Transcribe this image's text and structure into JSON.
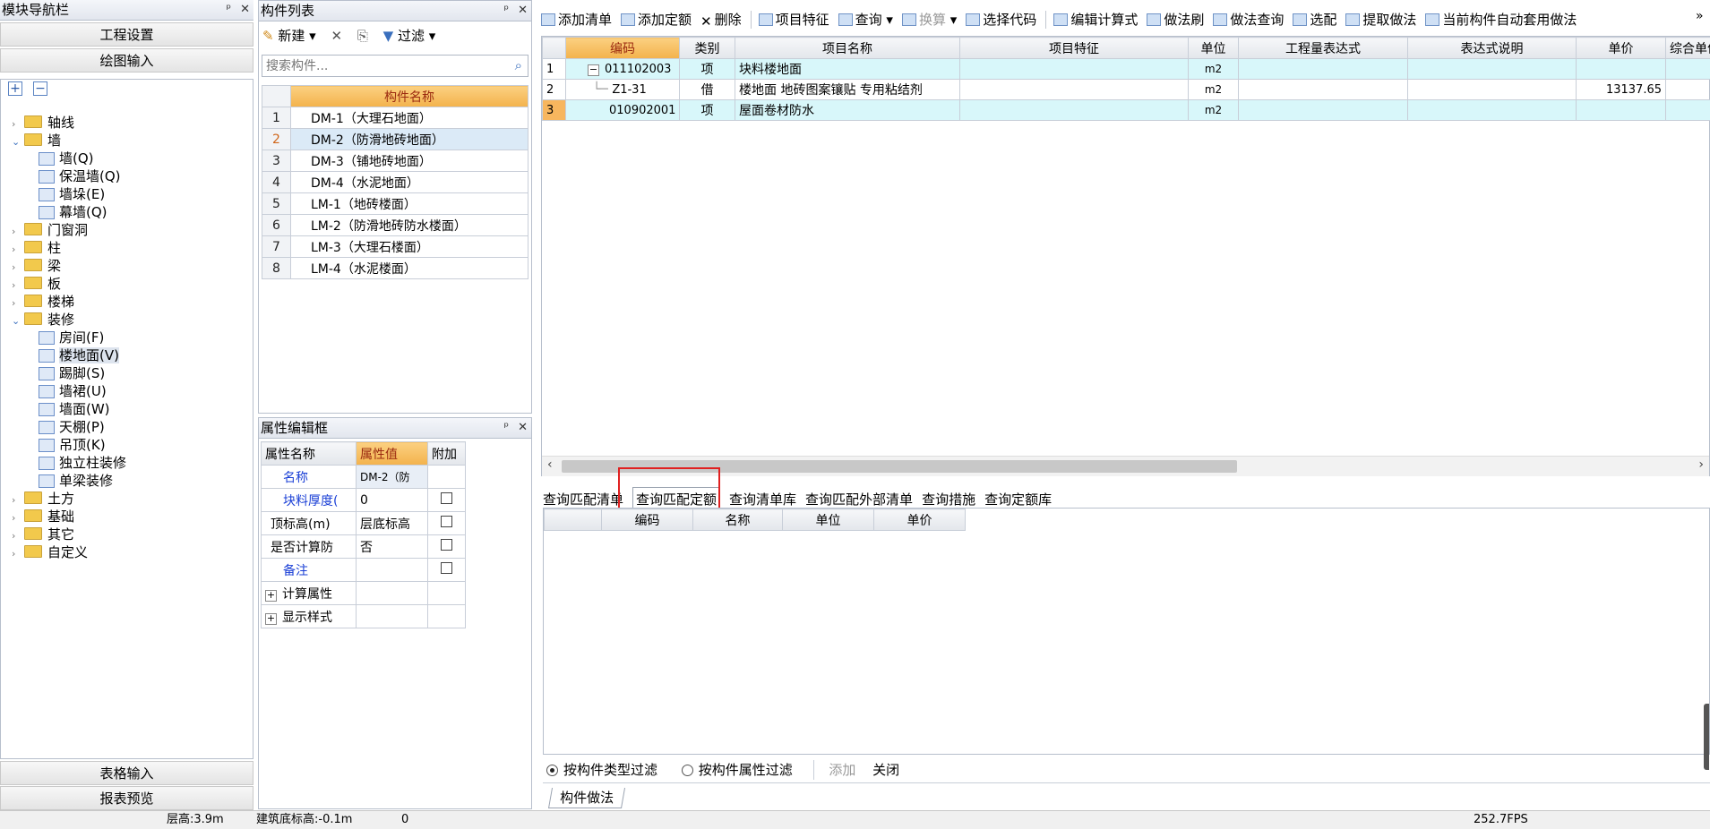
{
  "nav": {
    "title": "模块导航栏",
    "pin_icon": "pin-icon",
    "close_icon": "close-icon",
    "buttons": [
      "工程设置",
      "绘图输入"
    ],
    "bottom_buttons": [
      "表格输入",
      "报表预览"
    ],
    "tree": [
      {
        "label": "轴线",
        "level": 0,
        "state": "collapsed"
      },
      {
        "label": "墙",
        "level": 0,
        "state": "expanded"
      },
      {
        "label": "墙(Q)",
        "level": 1
      },
      {
        "label": "保温墙(Q)",
        "level": 1
      },
      {
        "label": "墙垛(E)",
        "level": 1
      },
      {
        "label": "幕墙(Q)",
        "level": 1
      },
      {
        "label": "门窗洞",
        "level": 0,
        "state": "collapsed"
      },
      {
        "label": "柱",
        "level": 0,
        "state": "collapsed"
      },
      {
        "label": "梁",
        "level": 0,
        "state": "collapsed"
      },
      {
        "label": "板",
        "level": 0,
        "state": "collapsed"
      },
      {
        "label": "楼梯",
        "level": 0,
        "state": "collapsed"
      },
      {
        "label": "装修",
        "level": 0,
        "state": "expanded"
      },
      {
        "label": "房间(F)",
        "level": 1
      },
      {
        "label": "楼地面(V)",
        "level": 1,
        "selected": true
      },
      {
        "label": "踢脚(S)",
        "level": 1
      },
      {
        "label": "墙裙(U)",
        "level": 1
      },
      {
        "label": "墙面(W)",
        "level": 1
      },
      {
        "label": "天棚(P)",
        "level": 1
      },
      {
        "label": "吊顶(K)",
        "level": 1
      },
      {
        "label": "独立柱装修",
        "level": 1
      },
      {
        "label": "单梁装修",
        "level": 1
      },
      {
        "label": "土方",
        "level": 0,
        "state": "collapsed"
      },
      {
        "label": "基础",
        "level": 0,
        "state": "collapsed"
      },
      {
        "label": "其它",
        "level": 0,
        "state": "collapsed"
      },
      {
        "label": "自定义",
        "level": 0,
        "state": "collapsed"
      }
    ]
  },
  "components": {
    "title": "构件列表",
    "new_label": "新建",
    "filter_label": "过滤",
    "search_placeholder": "搜索构件...",
    "column_header": "构件名称",
    "rows": [
      {
        "num": "1",
        "name": "DM-1（大理石地面）"
      },
      {
        "num": "2",
        "name": "DM-2（防滑地砖地面）",
        "selected": true
      },
      {
        "num": "3",
        "name": "DM-3（铺地砖地面）"
      },
      {
        "num": "4",
        "name": "DM-4（水泥地面）"
      },
      {
        "num": "5",
        "name": "LM-1（地砖楼面）"
      },
      {
        "num": "6",
        "name": "LM-2（防滑地砖防水楼面）"
      },
      {
        "num": "7",
        "name": "LM-3（大理石楼面）"
      },
      {
        "num": "8",
        "name": "LM-4（水泥楼面）"
      }
    ]
  },
  "properties": {
    "title": "属性编辑框",
    "headers": [
      "属性名称",
      "属性值",
      "附加"
    ],
    "rows": [
      {
        "name": "名称",
        "value": "DM-2（防",
        "blue": true,
        "check": false
      },
      {
        "name": "块料厚度(",
        "value": "0",
        "blue": true,
        "check": true
      },
      {
        "name": "顶标高(m)",
        "value": "层底标高",
        "blue": false,
        "check": true
      },
      {
        "name": "是否计算防",
        "value": "否",
        "blue": false,
        "check": true
      },
      {
        "name": "备注",
        "value": "",
        "blue": true,
        "check": true
      },
      {
        "name": "计算属性",
        "value": "",
        "expander": true
      },
      {
        "name": "显示样式",
        "value": "",
        "expander": true
      }
    ]
  },
  "toolbar": {
    "items": [
      "添加清单",
      "添加定额",
      "删除",
      "项目特征",
      "查询",
      "换算",
      "选择代码",
      "编辑计算式",
      "做法刷",
      "做法查询",
      "选配",
      "提取做法",
      "当前构件自动套用做法"
    ]
  },
  "main_table": {
    "headers": [
      "编码",
      "类别",
      "项目名称",
      "项目特征",
      "单位",
      "工程量表达式",
      "表达式说明",
      "单价",
      "综合单价"
    ],
    "rows": [
      {
        "num": "1",
        "code": "011102003",
        "type": "项",
        "name": "块料楼地面",
        "feature": "",
        "unit": "m2",
        "expr": "",
        "desc": "",
        "price": "",
        "cyan": true,
        "expander": "−"
      },
      {
        "num": "2",
        "code": "Z1-31",
        "type": "借",
        "name": "楼地面 地砖图案镶贴 专用粘结剂",
        "feature": "",
        "unit": "m2",
        "expr": "",
        "desc": "",
        "price": "13137.65",
        "cyan": false,
        "expander": ""
      },
      {
        "num": "3",
        "code": "010902001",
        "type": "项",
        "name": "屋面卷材防水",
        "feature": "",
        "unit": "m2",
        "expr": "",
        "desc": "",
        "price": "",
        "cyan": true,
        "expander": ""
      }
    ]
  },
  "lower_tabs": [
    "查询匹配清单",
    "查询匹配定额",
    "查询清单库",
    "查询匹配外部清单",
    "查询措施",
    "查询定额库"
  ],
  "lower_table_headers": [
    "编码",
    "名称",
    "单位",
    "单价"
  ],
  "filter_bar": {
    "option1": "按构件类型过滤",
    "option2": "按构件属性过滤",
    "add": "添加",
    "close": "关闭"
  },
  "bottom_tab": "构件做法",
  "status": {
    "floor_height": "层高:3.9m",
    "base_elev": "建筑底标高:-0.1m",
    "zero": "0",
    "fps": "252.7FPS"
  }
}
